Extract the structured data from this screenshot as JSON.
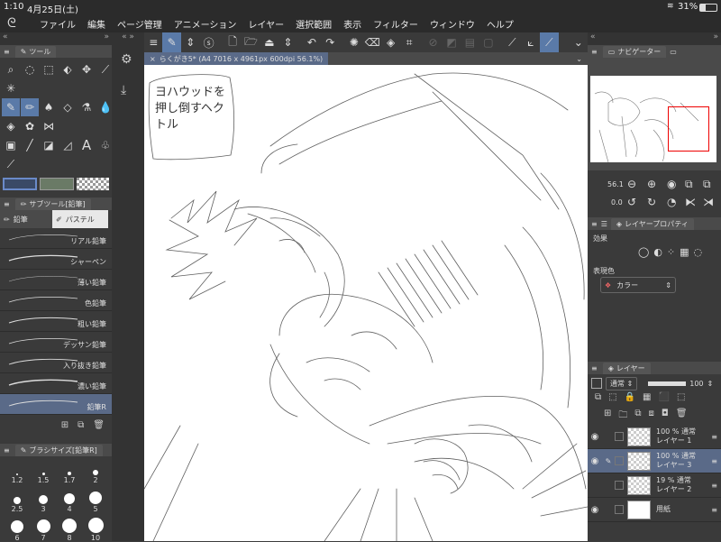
{
  "status": {
    "time": "1:10",
    "date": "4月25日(土)",
    "battery": "31%"
  },
  "menu": [
    "ファイル",
    "編集",
    "ページ管理",
    "アニメーション",
    "レイヤー",
    "選択範囲",
    "表示",
    "フィルター",
    "ウィンドウ",
    "ヘルプ"
  ],
  "tool_panel": {
    "title": "ツール"
  },
  "subtool_panel": {
    "title": "サブツール[鉛筆]",
    "tab_pencil": "鉛筆",
    "tab_pastel": "パステル"
  },
  "brushes": [
    "リアル鉛筆",
    "シャーペン",
    "薄い鉛筆",
    "色鉛筆",
    "粗い鉛筆",
    "デッサン鉛筆",
    "入り抜き鉛筆",
    "濃い鉛筆",
    "鉛筆R"
  ],
  "selected_brush_index": 8,
  "brush_size_panel": {
    "title": "ブラシサイズ[鉛筆R]"
  },
  "brush_sizes": [
    "1.2",
    "1.5",
    "1.7",
    "2",
    "2.5",
    "3",
    "4",
    "5",
    "6",
    "7",
    "8",
    "10"
  ],
  "canvas": {
    "tab_title": "らくがき5* (A4 7016 x 4961px 600dpi 56.1%)",
    "note": "ヨハウッドを押し倒すヘクトル"
  },
  "navigator": {
    "title": "ナビゲーター",
    "zoom": "56.1",
    "rotation": "0.0"
  },
  "layer_property": {
    "title": "レイヤープロパティ",
    "effect_label": "効果",
    "expression_label": "表現色",
    "expression_value": "カラー"
  },
  "layers_panel": {
    "title": "レイヤー",
    "blend_mode": "通常",
    "opacity": "100"
  },
  "layers": [
    {
      "pct": "100 %",
      "mode": "通常",
      "name": "レイヤー 1",
      "visible": true,
      "selected": false,
      "paper": false
    },
    {
      "pct": "100 %",
      "mode": "通常",
      "name": "レイヤー 3",
      "visible": true,
      "selected": true,
      "paper": false
    },
    {
      "pct": "19 %",
      "mode": "通常",
      "name": "レイヤー 2",
      "visible": false,
      "selected": false,
      "paper": false
    },
    {
      "pct": "",
      "mode": "",
      "name": "用紙",
      "visible": true,
      "selected": false,
      "paper": true
    }
  ],
  "colors": {
    "accent": "#5a7aa8",
    "main_color": "#3a4a66",
    "sub_color": "#6a7a66",
    "selection": "#5a6a88"
  }
}
